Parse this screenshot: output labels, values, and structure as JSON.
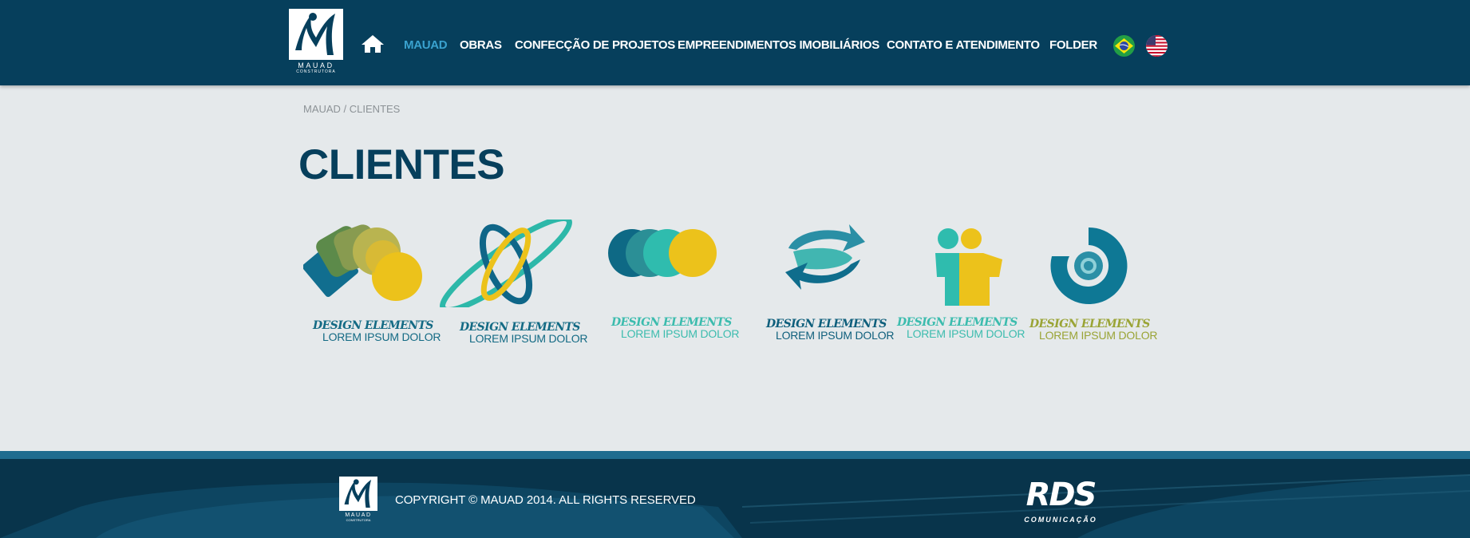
{
  "header": {
    "logo_name": "MAUAD",
    "logo_sub": "CONSTRUTORA",
    "home_icon": "home-icon",
    "nav": [
      {
        "label": "MAUAD",
        "active": true
      },
      {
        "label": "OBRAS",
        "active": false
      },
      {
        "label": "CONFECÇÃO DE PROJETOS",
        "active": false
      },
      {
        "label": "EMPREENDIMENTOS IMOBILIÁRIOS",
        "active": false
      },
      {
        "label": "CONTATO E ATENDIMENTO",
        "active": false
      },
      {
        "label": "FOLDER",
        "active": false
      }
    ],
    "languages": [
      "brazil-flag-icon",
      "usa-flag-icon"
    ]
  },
  "breadcrumb": "MAUAD / CLIENTES",
  "page_title": "CLIENTES",
  "clients": [
    {
      "line1": "DESIGN ELEMENTS",
      "line2": "LOREM IPSUM DOLOR",
      "icon": "overlapping-squares-circles-logo"
    },
    {
      "line1": "DESIGN ELEMENTS",
      "line2": "LOREM IPSUM DOLOR",
      "icon": "orbit-ellipses-logo"
    },
    {
      "line1": "DESIGN ELEMENTS",
      "line2": "LOREM IPSUM DOLOR",
      "icon": "four-circles-logo"
    },
    {
      "line1": "DESIGN ELEMENTS",
      "line2": "LOREM IPSUM DOLOR",
      "icon": "swirl-arrows-logo"
    },
    {
      "line1": "DESIGN ELEMENTS",
      "line2": "LOREM IPSUM DOLOR",
      "icon": "two-people-logo"
    },
    {
      "line1": "DESIGN ELEMENTS",
      "line2": "LOREM IPSUM DOLOR",
      "icon": "ring-target-logo"
    }
  ],
  "footer": {
    "logo_name": "MAUAD",
    "logo_sub": "CONSTRUTORA",
    "copyright": "COPYRIGHT © MAUAD 2014. ALL RIGHTS RESERVED",
    "agency_name": "RDS",
    "agency_sub": "COMUNICAÇÃO"
  },
  "colors": {
    "header_bg": "#063f5c",
    "page_bg": "#e5e9eb",
    "active_nav": "#3aa2cf",
    "title": "#063f5c",
    "footer_stripe": "#1f6c8f"
  }
}
